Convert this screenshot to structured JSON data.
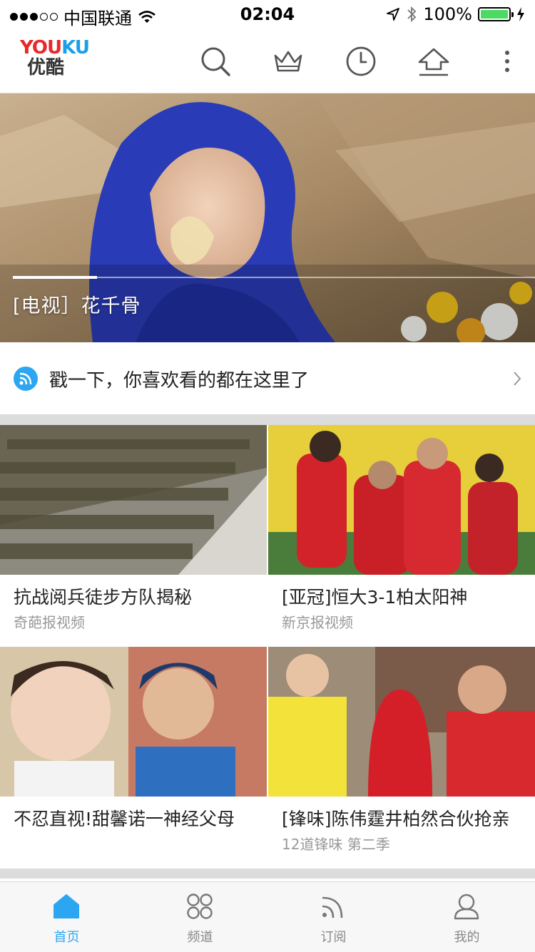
{
  "status_bar": {
    "carrier": "中国联通",
    "time": "02:04",
    "battery_text": "100%",
    "battery_level": 1.0,
    "signal_bars_filled": 3,
    "signal_bars_total": 5
  },
  "header": {
    "logo_en": "YOUKU",
    "logo_cn": "优酷",
    "icons": [
      "search-icon",
      "crown-icon",
      "history-clock-icon",
      "upload-icon",
      "more-vertical-icon"
    ]
  },
  "hero": {
    "caption": "[电视］花千骨",
    "slide_index": 1
  },
  "recommend_banner": {
    "text": "戳一下，你喜欢看的都在这里了"
  },
  "feed": [
    {
      "title": "抗战阅兵徒步方队揭秘",
      "source": "奇葩报视频"
    },
    {
      "title": "[亚冠]恒大3-1柏太阳神",
      "source": "新京报视频"
    },
    {
      "title": "不忍直视!甜馨诺一神经父母",
      "source": ""
    },
    {
      "title": "[锋味]陈伟霆井柏然合伙抢亲",
      "source": "12道锋味 第二季"
    }
  ],
  "tabbar": {
    "tabs": [
      {
        "label": "首页",
        "icon": "home-icon",
        "active": true
      },
      {
        "label": "频道",
        "icon": "channels-grid-icon",
        "active": false
      },
      {
        "label": "订阅",
        "icon": "subscribe-rss-icon",
        "active": false
      },
      {
        "label": "我的",
        "icon": "profile-user-icon",
        "active": false
      }
    ]
  },
  "colors": {
    "accent": "#2da6f2",
    "logo_red": "#e8282b",
    "logo_blue": "#1aa0e6",
    "battery_green": "#4cd964"
  }
}
